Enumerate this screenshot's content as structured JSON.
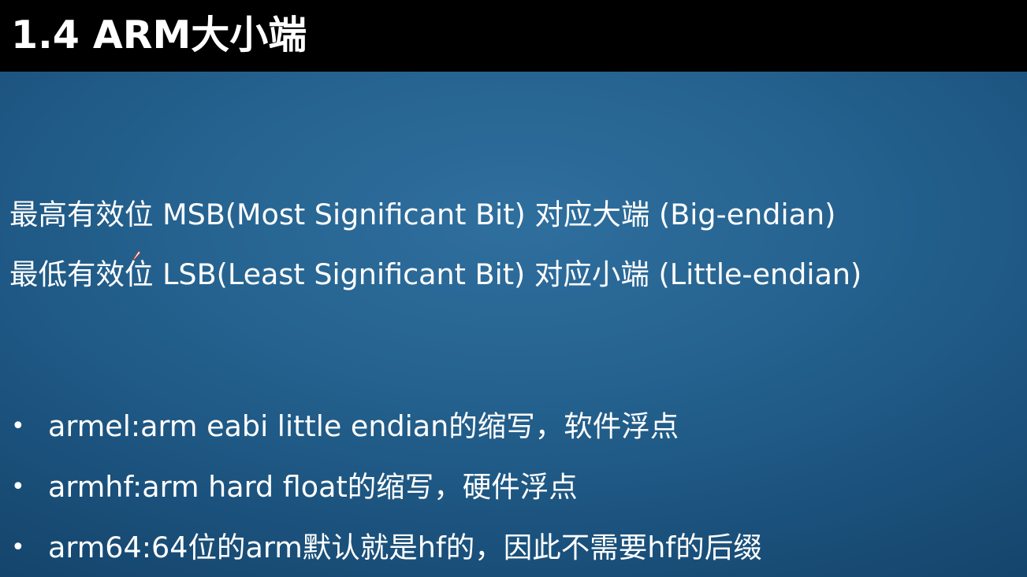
{
  "slide": {
    "title": "1.4 ARM大小端",
    "definitions": [
      "最高有效位 MSB(Most Significant Bit) 对应大端 (Big-endian)",
      "最低有效位 LSB(Least Significant Bit) 对应小端 (Little-endian)"
    ],
    "bullet_glyph": "•",
    "bullets": [
      "armel:arm eabi little endian的缩写，软件浮点",
      "armhf:arm hard float的缩写，硬件浮点",
      "arm64:64位的arm默认就是hf的，因此不需要hf的后缀"
    ]
  },
  "colors": {
    "title_bar": "#000000",
    "background_center": "#2f6f9e",
    "background_edge": "#123f64",
    "text": "#ffffff"
  },
  "icons": {
    "cursor": "pen-cursor-icon"
  }
}
